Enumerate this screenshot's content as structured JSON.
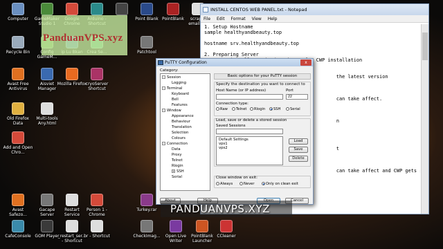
{
  "watermark": "PanduanVPS.xyz",
  "banner": "PANDUANVPS.XYZ",
  "desktop_icons": [
    {
      "label": "Computer",
      "icon": "computer-icon",
      "color": "#6a8fc0"
    },
    {
      "label": "GameMaker Studio 1",
      "icon": "gamemaker-icon",
      "color": "#4a8a3a"
    },
    {
      "label": "Google Chrome",
      "icon": "chrome-icon",
      "color": "#d44a3a"
    },
    {
      "label": "Arduino - Shortcut",
      "icon": "arduino-icon",
      "color": "#2a8a8a"
    },
    {
      "label": "",
      "icon": "app-icon",
      "color": "#444"
    },
    {
      "label": "Point Blank",
      "icon": "pointblank-icon",
      "color": "#2a4a8a"
    },
    {
      "label": "PointBlank",
      "icon": "pointblank-icon",
      "color": "#aa2222"
    },
    {
      "label": "scrape-emails-...",
      "icon": "file-icon",
      "color": "#ddd"
    },
    {
      "label": "Recycle Bin",
      "icon": "recycle-bin-icon",
      "color": "#9ab"
    },
    {
      "label": "Config GameM...",
      "icon": "config-icon",
      "color": "#4a8a3a"
    },
    {
      "label": "ip Lu Bkan",
      "icon": "app-icon",
      "color": "#3a6ab0"
    },
    {
      "label": "Crea Se...",
      "icon": "app-icon",
      "color": "#3aa06a"
    },
    {
      "label": "Patchtool",
      "icon": "patchtool-icon",
      "color": "#777"
    },
    {
      "label": "Avast Free Antivirus",
      "icon": "avast-icon",
      "color": "#e07020"
    },
    {
      "label": "Aisviet Manager",
      "icon": "app-icon",
      "color": "#3a6ab0"
    },
    {
      "label": "Mozilla Firefox",
      "icon": "firefox-icon",
      "color": "#e86a20"
    },
    {
      "label": "cryoServer Shortcut",
      "icon": "app-icon",
      "color": "#aa3366"
    },
    {
      "label": "Old Firefox Data",
      "icon": "folder-icon",
      "color": "#e0b040"
    },
    {
      "label": "Multi-tools Any.html",
      "icon": "html-icon",
      "color": "#ddd"
    },
    {
      "label": "Add and Open Chro...",
      "icon": "chrome-icon",
      "color": "#d44a3a"
    },
    {
      "label": "Avast Safezo...",
      "icon": "avast-icon",
      "color": "#e07020"
    },
    {
      "label": "Gacape Server",
      "icon": "app-icon",
      "color": "#777"
    },
    {
      "label": "Restart Service",
      "icon": "restart-icon",
      "color": "#ddd"
    },
    {
      "label": "Person 1 - Chrome",
      "icon": "chrome-icon",
      "color": "#d44a3a"
    },
    {
      "label": "Turkey.rar",
      "icon": "rar-icon",
      "color": "#8a3a8a"
    },
    {
      "label": "CafeConsole",
      "icon": "app-icon",
      "color": "#3a8aaa"
    },
    {
      "label": "GOM Player",
      "icon": "gom-icon",
      "color": "#3a3a3a"
    },
    {
      "label": "_restart_ser... - Shortcut",
      "icon": "shortcut-icon",
      "color": "#ddd"
    },
    {
      "label": "br - Shortcut",
      "icon": "shortcut-icon",
      "color": "#ddd"
    },
    {
      "label": "CheckImag...",
      "icon": "app-icon",
      "color": "#777"
    },
    {
      "label": "Open Live Writer",
      "icon": "writer-icon",
      "color": "#7a3aa0"
    },
    {
      "label": "PointBlank Launcher",
      "icon": "pointblank-icon",
      "color": "#cc5522"
    },
    {
      "label": "CCleaner",
      "icon": "ccleaner-icon",
      "color": "#cc3333"
    }
  ],
  "notepad": {
    "title": "INSTALL CENTOS WEB PANEL.txt - Notepad",
    "menu": [
      "File",
      "Edit",
      "Format",
      "View",
      "Help"
    ],
    "lines": [
      "1. Setup Hostname",
      "sample healthyandbeauty.top",
      "",
      "hostname srv.healthyandbeauty.top",
      "",
      "2. Preparing Server",
      "   Let's install required packages for CWP installation",
      "",
      "",
      "                                              the latest version",
      "",
      "",
      "",
      "                                              can take affect.",
      "",
      "",
      "",
      "                                              n",
      "",
      "",
      "",
      "",
      "                                              t",
      "",
      "",
      "",
      "                                              can take affect and CWP gets started."
    ]
  },
  "putty": {
    "title": "PuTTY Configuration",
    "close": "x",
    "category_label": "Category:",
    "tree": [
      {
        "label": "Session",
        "level": 0,
        "exp": "-"
      },
      {
        "label": "Logging",
        "level": 1
      },
      {
        "label": "Terminal",
        "level": 0,
        "exp": "-"
      },
      {
        "label": "Keyboard",
        "level": 1
      },
      {
        "label": "Bell",
        "level": 1
      },
      {
        "label": "Features",
        "level": 1
      },
      {
        "label": "Window",
        "level": 0,
        "exp": "-"
      },
      {
        "label": "Appearance",
        "level": 1
      },
      {
        "label": "Behaviour",
        "level": 1
      },
      {
        "label": "Translation",
        "level": 1
      },
      {
        "label": "Selection",
        "level": 1
      },
      {
        "label": "Colours",
        "level": 1
      },
      {
        "label": "Connection",
        "level": 0,
        "exp": "-"
      },
      {
        "label": "Data",
        "level": 1
      },
      {
        "label": "Proxy",
        "level": 1
      },
      {
        "label": "Telnet",
        "level": 1
      },
      {
        "label": "Rlogin",
        "level": 1
      },
      {
        "label": "SSH",
        "level": 1,
        "exp": "+"
      },
      {
        "label": "Serial",
        "level": 1
      }
    ],
    "header": "Basic options for your PuTTY session",
    "dest_label": "Specify the destination you want to connect to",
    "host_label": "Host Name (or IP address)",
    "host_value": "",
    "port_label": "Port",
    "port_value": "22",
    "conn_type_label": "Connection type:",
    "conn_types": [
      "Raw",
      "Telnet",
      "Rlogin",
      "SSH",
      "Serial"
    ],
    "conn_selected": "SSH",
    "load_label": "Load, save or delete a stored session",
    "saved_label": "Saved Sessions",
    "saved_value": "",
    "sessions": [
      "Default Settings",
      "vps1",
      "vps2"
    ],
    "btn_load": "Load",
    "btn_save": "Save",
    "btn_delete": "Delete",
    "close_label": "Close window on exit:",
    "close_opts": [
      "Always",
      "Never",
      "Only on clean exit"
    ],
    "close_selected": "Only on clean exit",
    "btn_about": "About",
    "btn_help": "Help",
    "btn_open": "Open",
    "btn_cancel": "Cancel"
  }
}
